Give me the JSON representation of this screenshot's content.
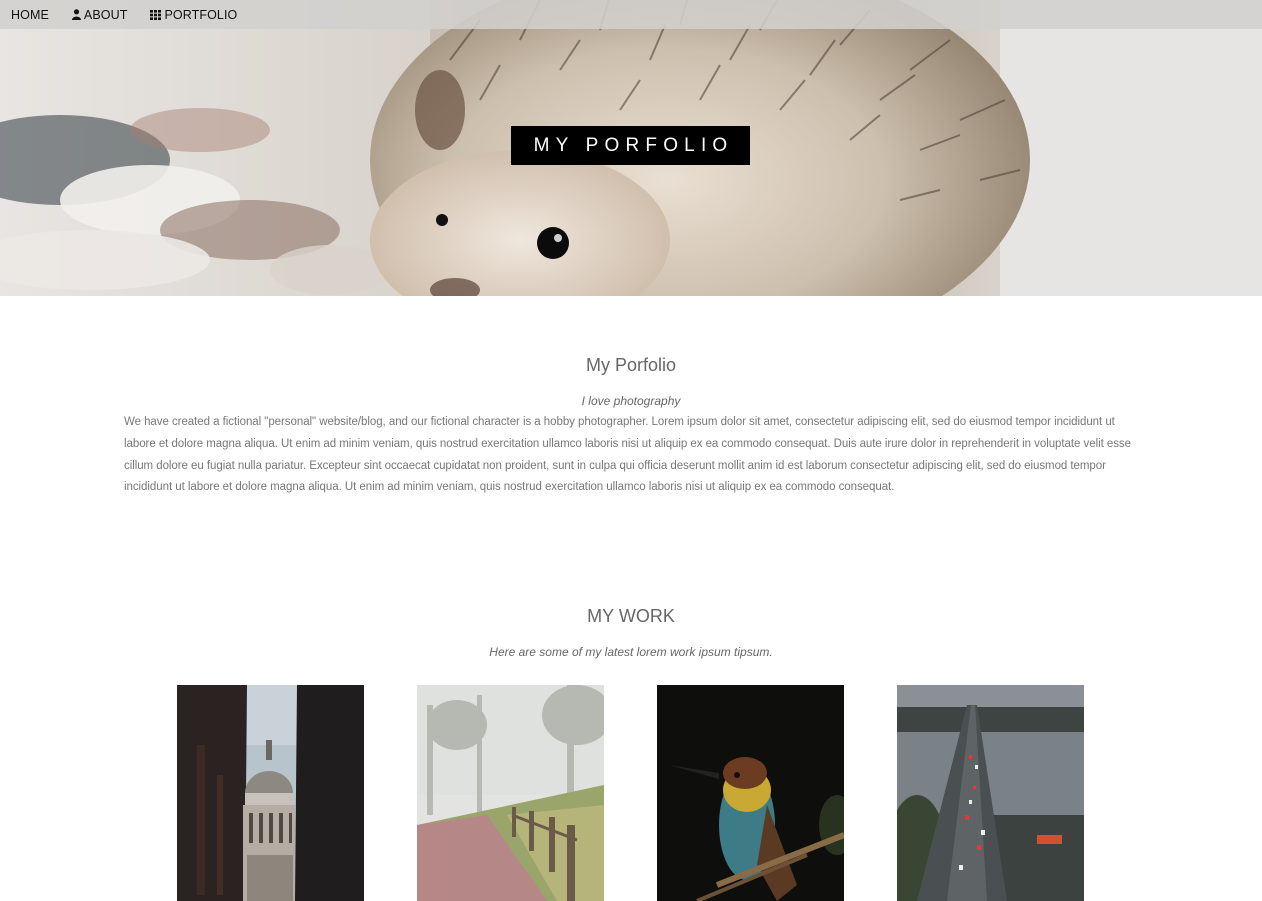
{
  "nav": {
    "items": [
      {
        "label": "HOME",
        "icon": ""
      },
      {
        "label": "ABOUT",
        "icon": "user-icon"
      },
      {
        "label": "PORTFOLIO",
        "icon": "grid-icon"
      }
    ]
  },
  "hero": {
    "title": "MY PORFOLIO"
  },
  "about": {
    "title": "My Porfolio",
    "tagline": "I love photography",
    "text": "We have created a fictional \"personal\" website/blog, and our fictional character is a hobby photographer. Lorem ipsum dolor sit amet, consectetur adipiscing elit, sed do eiusmod tempor incididunt ut labore et dolore magna aliqua. Ut enim ad minim veniam, quis nostrud exercitation ullamco laboris nisi ut aliquip ex ea commodo consequat. Duis aute irure dolor in reprehenderit in voluptate velit esse cillum dolore eu fugiat nulla pariatur. Excepteur sint occaecat cupidatat non proident, sunt in culpa qui officia deserunt mollit anim id est laborum consectetur adipiscing elit, sed do eiusmod tempor incididunt ut labore et dolore magna aliqua. Ut enim ad minim veniam, quis nostrud exercitation ullamco laboris nisi ut aliquip ex ea commodo consequat."
  },
  "work": {
    "title": "MY WORK",
    "subtitle": "Here are some of my latest lorem work ipsum tipsum."
  }
}
